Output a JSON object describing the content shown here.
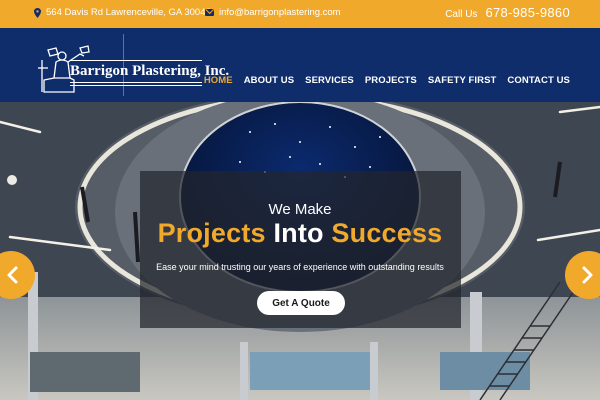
{
  "topbar": {
    "address": "564 Davis Rd Lawrenceville, GA 30046",
    "email": "info@barrigonplastering.com",
    "call_label": "Call Us",
    "phone": "678-985-9860",
    "icons": {
      "address": "map-pin-icon",
      "email": "envelope-icon"
    }
  },
  "header": {
    "logo_text": "Barrigon Plastering, Inc.",
    "nav": [
      {
        "label": "HOME",
        "active": true
      },
      {
        "label": "ABOUT US",
        "active": false
      },
      {
        "label": "SERVICES",
        "active": false
      },
      {
        "label": "PROJECTS",
        "active": false
      },
      {
        "label": "SAFETY FIRST",
        "active": false
      },
      {
        "label": "CONTACT US",
        "active": false
      }
    ]
  },
  "hero": {
    "heading_small": "We Make",
    "heading_large": "Projects Into Success",
    "subtitle": "Ease your mind trusting our years of experience with outstanding results",
    "cta_label": "Get A Quote",
    "prev_icon": "chevron-left-icon",
    "next_icon": "chevron-right-icon"
  },
  "colors": {
    "accent": "#f1a92b",
    "navy": "#0f2d6b",
    "white": "#ffffff"
  }
}
